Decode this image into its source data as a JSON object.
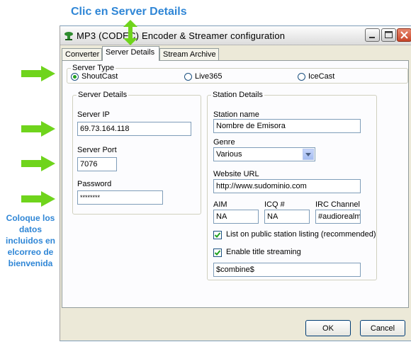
{
  "annotation": {
    "title": "Clic en Server Details",
    "note": "Coloque los datos incluidos en elcorreo de bienvenida"
  },
  "window": {
    "title": "MP3 (CODEC) Encoder & Streamer configuration",
    "icon": "green-speaker-icon"
  },
  "tabs": [
    {
      "label": "Converter",
      "active": false
    },
    {
      "label": "Server Details",
      "active": true
    },
    {
      "label": "Stream Archive",
      "active": false
    }
  ],
  "server_type": {
    "legend": "Server Type",
    "options": [
      {
        "label": "ShoutCast",
        "selected": true
      },
      {
        "label": "Live365",
        "selected": false
      },
      {
        "label": "IceCast",
        "selected": false
      }
    ]
  },
  "server_details": {
    "legend": "Server Details",
    "ip_label": "Server IP",
    "ip_value": "69.73.164.118",
    "port_label": "Server Port",
    "port_value": "7076",
    "password_label": "Password",
    "password_value": "********"
  },
  "station_details": {
    "legend": "Station Details",
    "name_label": "Station name",
    "name_value": "Nombre de Emisora",
    "genre_label": "Genre",
    "genre_value": "Various",
    "url_label": "Website URL",
    "url_value": "http://www.sudominio.com",
    "aim_label": "AIM",
    "aim_value": "NA",
    "icq_label": "ICQ #",
    "icq_value": "NA",
    "irc_label": "IRC Channel",
    "irc_value": "#audiorealm",
    "list_public_label": "List on public station listing (recommended)",
    "list_public_checked": true,
    "title_stream_label": "Enable title streaming",
    "title_stream_checked": true,
    "title_format_value": "$combine$"
  },
  "buttons": {
    "ok": "OK",
    "cancel": "Cancel"
  },
  "colors": {
    "annotation_blue": "#2f86d6",
    "arrow_green": "#6fd41c"
  }
}
